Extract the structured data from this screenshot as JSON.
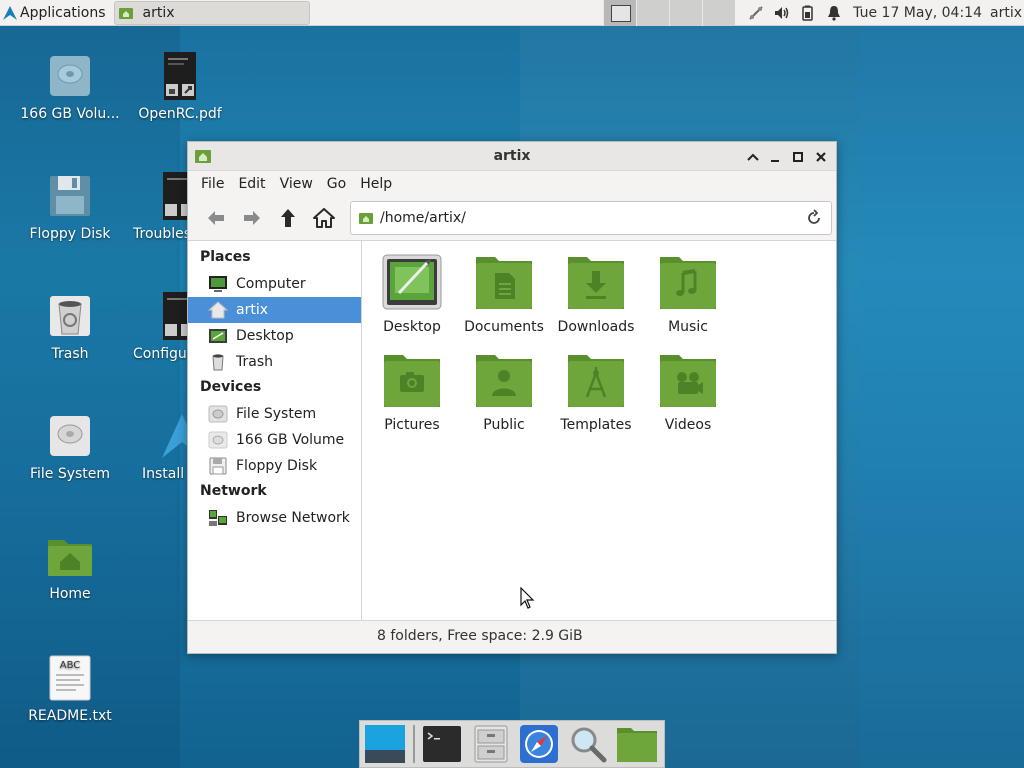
{
  "panel": {
    "applications_label": "Applications",
    "task_title": "artix",
    "clock": "Tue 17 May, 04:14",
    "user": "artix"
  },
  "desktop_icons": [
    {
      "label": "166 GB Volu...",
      "icon": "drive-icon"
    },
    {
      "label": "OpenRC.pdf",
      "icon": "pdf-icon"
    },
    {
      "label": "Floppy Disk",
      "icon": "floppy-icon"
    },
    {
      "label": "Troubles",
      "icon": "document-icon"
    },
    {
      "label": "Trash",
      "icon": "trash-icon"
    },
    {
      "label": "Configur",
      "icon": "document-icon"
    },
    {
      "label": "File System",
      "icon": "drive-icon"
    },
    {
      "label": "Install",
      "icon": "artix-logo-icon"
    },
    {
      "label": "Home",
      "icon": "home-folder-icon"
    },
    {
      "label": "README.txt",
      "icon": "text-file-icon"
    }
  ],
  "window": {
    "title": "artix",
    "menu": [
      "File",
      "Edit",
      "View",
      "Go",
      "Help"
    ],
    "path": "/home/artix/",
    "sidebar": {
      "places_header": "Places",
      "places": [
        "Computer",
        "artix",
        "Desktop",
        "Trash"
      ],
      "devices_header": "Devices",
      "devices": [
        "File System",
        "166 GB Volume",
        "Floppy Disk"
      ],
      "network_header": "Network",
      "network": [
        "Browse Network"
      ]
    },
    "folders": [
      "Desktop",
      "Documents",
      "Downloads",
      "Music",
      "Pictures",
      "Public",
      "Templates",
      "Videos"
    ],
    "status": "8 folders, Free space: 2.9 GiB"
  },
  "colors": {
    "folder_green": "#6a9f3c",
    "selection_blue": "#4a90d9"
  }
}
